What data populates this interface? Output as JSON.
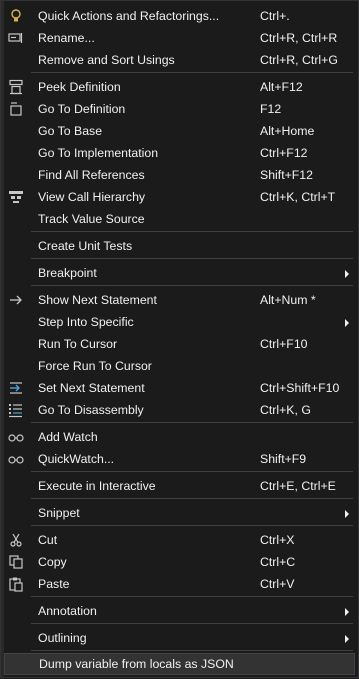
{
  "menu": {
    "quick_actions": {
      "label": "Quick Actions and Refactorings...",
      "shortcut": "Ctrl+."
    },
    "rename": {
      "label": "Rename...",
      "shortcut": "Ctrl+R, Ctrl+R"
    },
    "remove_sort_usings": {
      "label": "Remove and Sort Usings",
      "shortcut": "Ctrl+R, Ctrl+G"
    },
    "peek_definition": {
      "label": "Peek Definition",
      "shortcut": "Alt+F12"
    },
    "go_to_definition": {
      "label": "Go To Definition",
      "shortcut": "F12"
    },
    "go_to_base": {
      "label": "Go To Base",
      "shortcut": "Alt+Home"
    },
    "go_to_implementation": {
      "label": "Go To Implementation",
      "shortcut": "Ctrl+F12"
    },
    "find_all_references": {
      "label": "Find All References",
      "shortcut": "Shift+F12"
    },
    "view_call_hierarchy": {
      "label": "View Call Hierarchy",
      "shortcut": "Ctrl+K, Ctrl+T"
    },
    "track_value_source": {
      "label": "Track Value Source"
    },
    "create_unit_tests": {
      "label": "Create Unit Tests"
    },
    "breakpoint": {
      "label": "Breakpoint"
    },
    "show_next_statement": {
      "label": "Show Next Statement",
      "shortcut": "Alt+Num *"
    },
    "step_into_specific": {
      "label": "Step Into Specific"
    },
    "run_to_cursor": {
      "label": "Run To Cursor",
      "shortcut": "Ctrl+F10"
    },
    "force_run_to_cursor": {
      "label": "Force Run To Cursor"
    },
    "set_next_statement": {
      "label": "Set Next Statement",
      "shortcut": "Ctrl+Shift+F10"
    },
    "go_to_disassembly": {
      "label": "Go To Disassembly",
      "shortcut": "Ctrl+K, G"
    },
    "add_watch": {
      "label": "Add Watch"
    },
    "quickwatch": {
      "label": "QuickWatch...",
      "shortcut": "Shift+F9"
    },
    "execute_interactive": {
      "label": "Execute in Interactive",
      "shortcut": "Ctrl+E, Ctrl+E"
    },
    "snippet": {
      "label": "Snippet"
    },
    "cut": {
      "label": "Cut",
      "shortcut": "Ctrl+X"
    },
    "copy": {
      "label": "Copy",
      "shortcut": "Ctrl+C"
    },
    "paste": {
      "label": "Paste",
      "shortcut": "Ctrl+V"
    },
    "annotation": {
      "label": "Annotation"
    },
    "outlining": {
      "label": "Outlining"
    },
    "dump_variable": {
      "label": "Dump variable from locals as JSON"
    }
  },
  "colors": {
    "background": "#1b1b1c",
    "text": "#f1f1f1",
    "highlight": "#333334",
    "separator": "#3f3f46"
  }
}
